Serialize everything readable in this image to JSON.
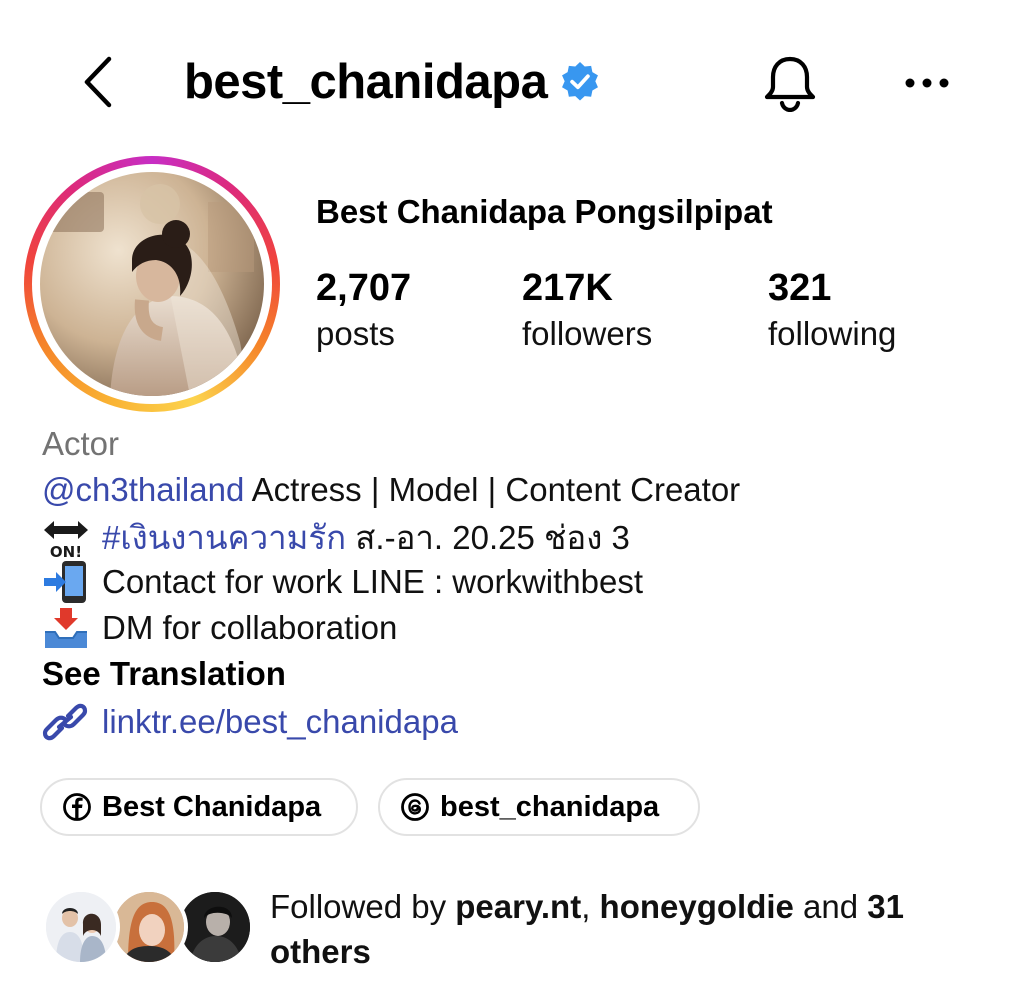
{
  "header": {
    "username": "best_chanidapa",
    "back_icon": "chevron-left-icon",
    "verified_icon": "verified-badge-icon",
    "bell_icon": "bell-icon",
    "more_icon": "more-horizontal-icon"
  },
  "profile": {
    "full_name": "Best Chanidapa Pongsilpipat",
    "stats": {
      "posts_count": "2,707",
      "posts_label": "posts",
      "followers_count": "217K",
      "followers_label": "followers",
      "following_count": "321",
      "following_label": "following"
    }
  },
  "bio": {
    "category": "Actor",
    "line1_mention": "@ch3thailand",
    "line1_text": " Actress | Model | Content Creator",
    "line2_hashtag": "#เงินงานความรัก",
    "line2_text": " ส.-อา. 20.25 ช่อง 3",
    "line3_text": "Contact for work LINE : workwithbest",
    "line4_text": "DM for collaboration",
    "see_translation": "See Translation",
    "emoji_icons": [
      "on-arrow-emoji-icon",
      "mobile-phone-arrow-emoji-icon",
      "inbox-tray-emoji-icon"
    ]
  },
  "link": {
    "icon": "link-icon",
    "text": "linktr.ee/best_chanidapa"
  },
  "pills": [
    {
      "icon": "facebook-icon",
      "label": "Best Chanidapa"
    },
    {
      "icon": "threads-icon",
      "label": "best_chanidapa"
    }
  ],
  "followed_by": {
    "prefix": "Followed by ",
    "user1": "peary.nt",
    "sep": ", ",
    "user2": "honeygoldie",
    "middle": " and ",
    "count": "31",
    "suffix_bold": "others"
  },
  "colors": {
    "link_blue": "#3949ab",
    "verified_blue": "#3897f0",
    "secondary_text": "#737373",
    "pill_border": "#e2e2e2"
  }
}
